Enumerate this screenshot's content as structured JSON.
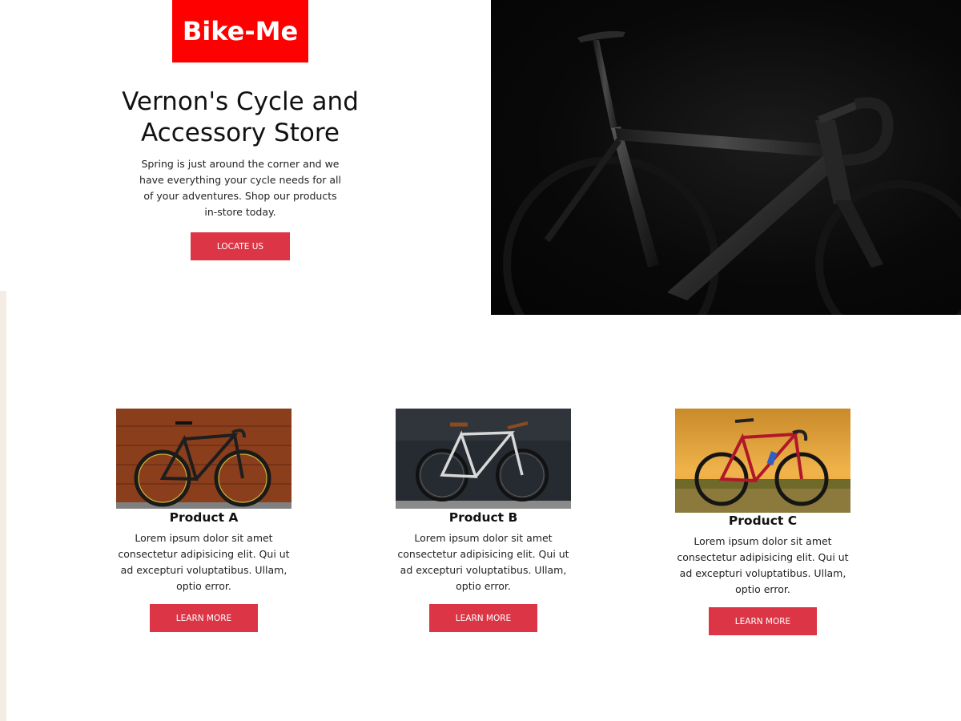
{
  "brand": {
    "logo_text": "Bike-Me",
    "color": "#ff0000"
  },
  "hero": {
    "title": "Vernon's Cycle and Accessory Store",
    "text": "Spring is just around the corner and we have everything your cycle needs for all of your adventures. Shop our products in-store today.",
    "button_label": "LOCATE US",
    "image_icon": "road-bike-dark-photo"
  },
  "accent_color": "#dc3545",
  "products": [
    {
      "name": "Product A",
      "description": "Lorem ipsum dolor sit amet consectetur adipisicing elit. Qui ut ad excepturi voluptatibus. Ullam, optio error.",
      "button_label": "LEARN MORE",
      "image_icon": "black-road-bike-wood-wall-photo"
    },
    {
      "name": "Product B",
      "description": "Lorem ipsum dolor sit amet consectetur adipisicing elit. Qui ut ad excepturi voluptatibus. Ullam, optio error.",
      "button_label": "LEARN MORE",
      "image_icon": "silver-fixie-bike-dark-wall-photo"
    },
    {
      "name": "Product C",
      "description": "Lorem ipsum dolor sit amet consectetur adipisicing elit. Qui ut ad excepturi voluptatibus. Ullam, optio error.",
      "button_label": "LEARN MORE",
      "image_icon": "red-road-bike-sunset-field-photo"
    }
  ]
}
